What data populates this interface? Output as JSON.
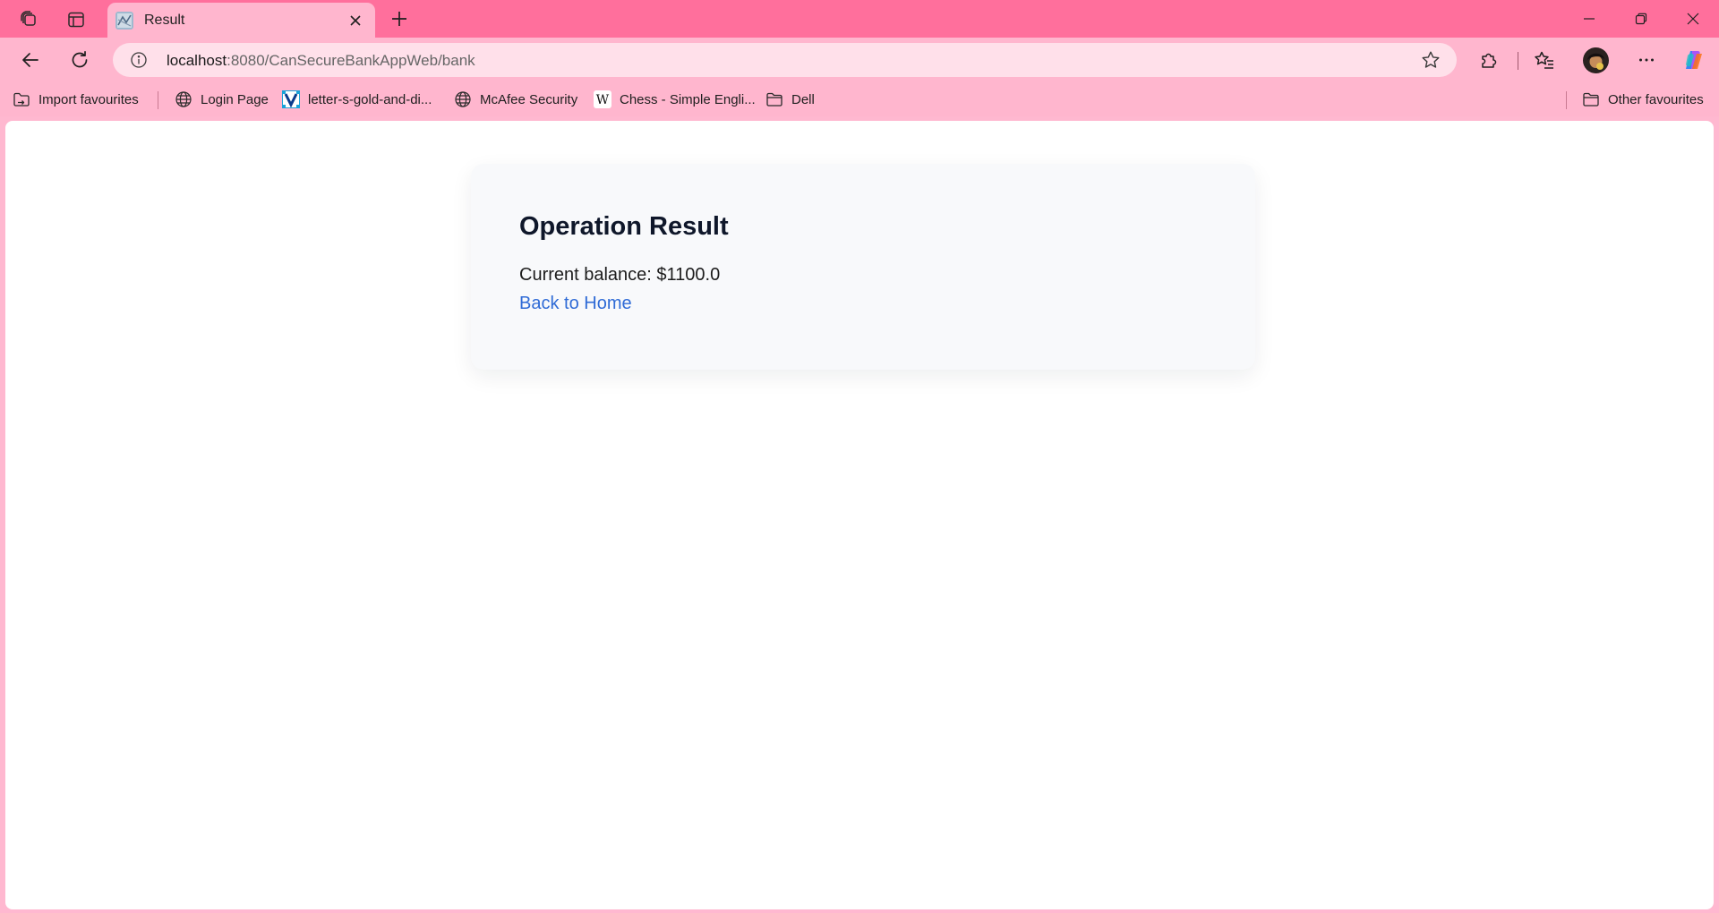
{
  "browser": {
    "tab": {
      "title": "Result"
    },
    "address_bar": {
      "host": "localhost",
      "path": ":8080/CanSecureBankAppWeb/bank"
    },
    "favourites": [
      {
        "label": "Import favourites",
        "icon": "import-favourites-icon"
      },
      {
        "label": "Login Page",
        "icon": "globe-icon"
      },
      {
        "label": "letter-s-gold-and-di...",
        "icon": "vector-v-icon"
      },
      {
        "label": "McAfee Security",
        "icon": "globe-icon"
      },
      {
        "label": "Chess - Simple Engli...",
        "icon": "wikipedia-w-icon"
      },
      {
        "label": "Dell",
        "icon": "folder-icon"
      }
    ],
    "other_favourites": {
      "label": "Other favourites",
      "icon": "folder-icon"
    },
    "colors": {
      "tab_strip": "#ff6f9c",
      "toolbar": "#ffb6ce",
      "omnibox": "#ffe0ea"
    }
  },
  "page": {
    "heading": "Operation Result",
    "balance_text": "Current balance: $1100.0",
    "home_link": "Back to Home",
    "colors": {
      "card_bg": "#f8f9fb",
      "heading": "#0f172a",
      "link": "#2f6bd6"
    }
  }
}
